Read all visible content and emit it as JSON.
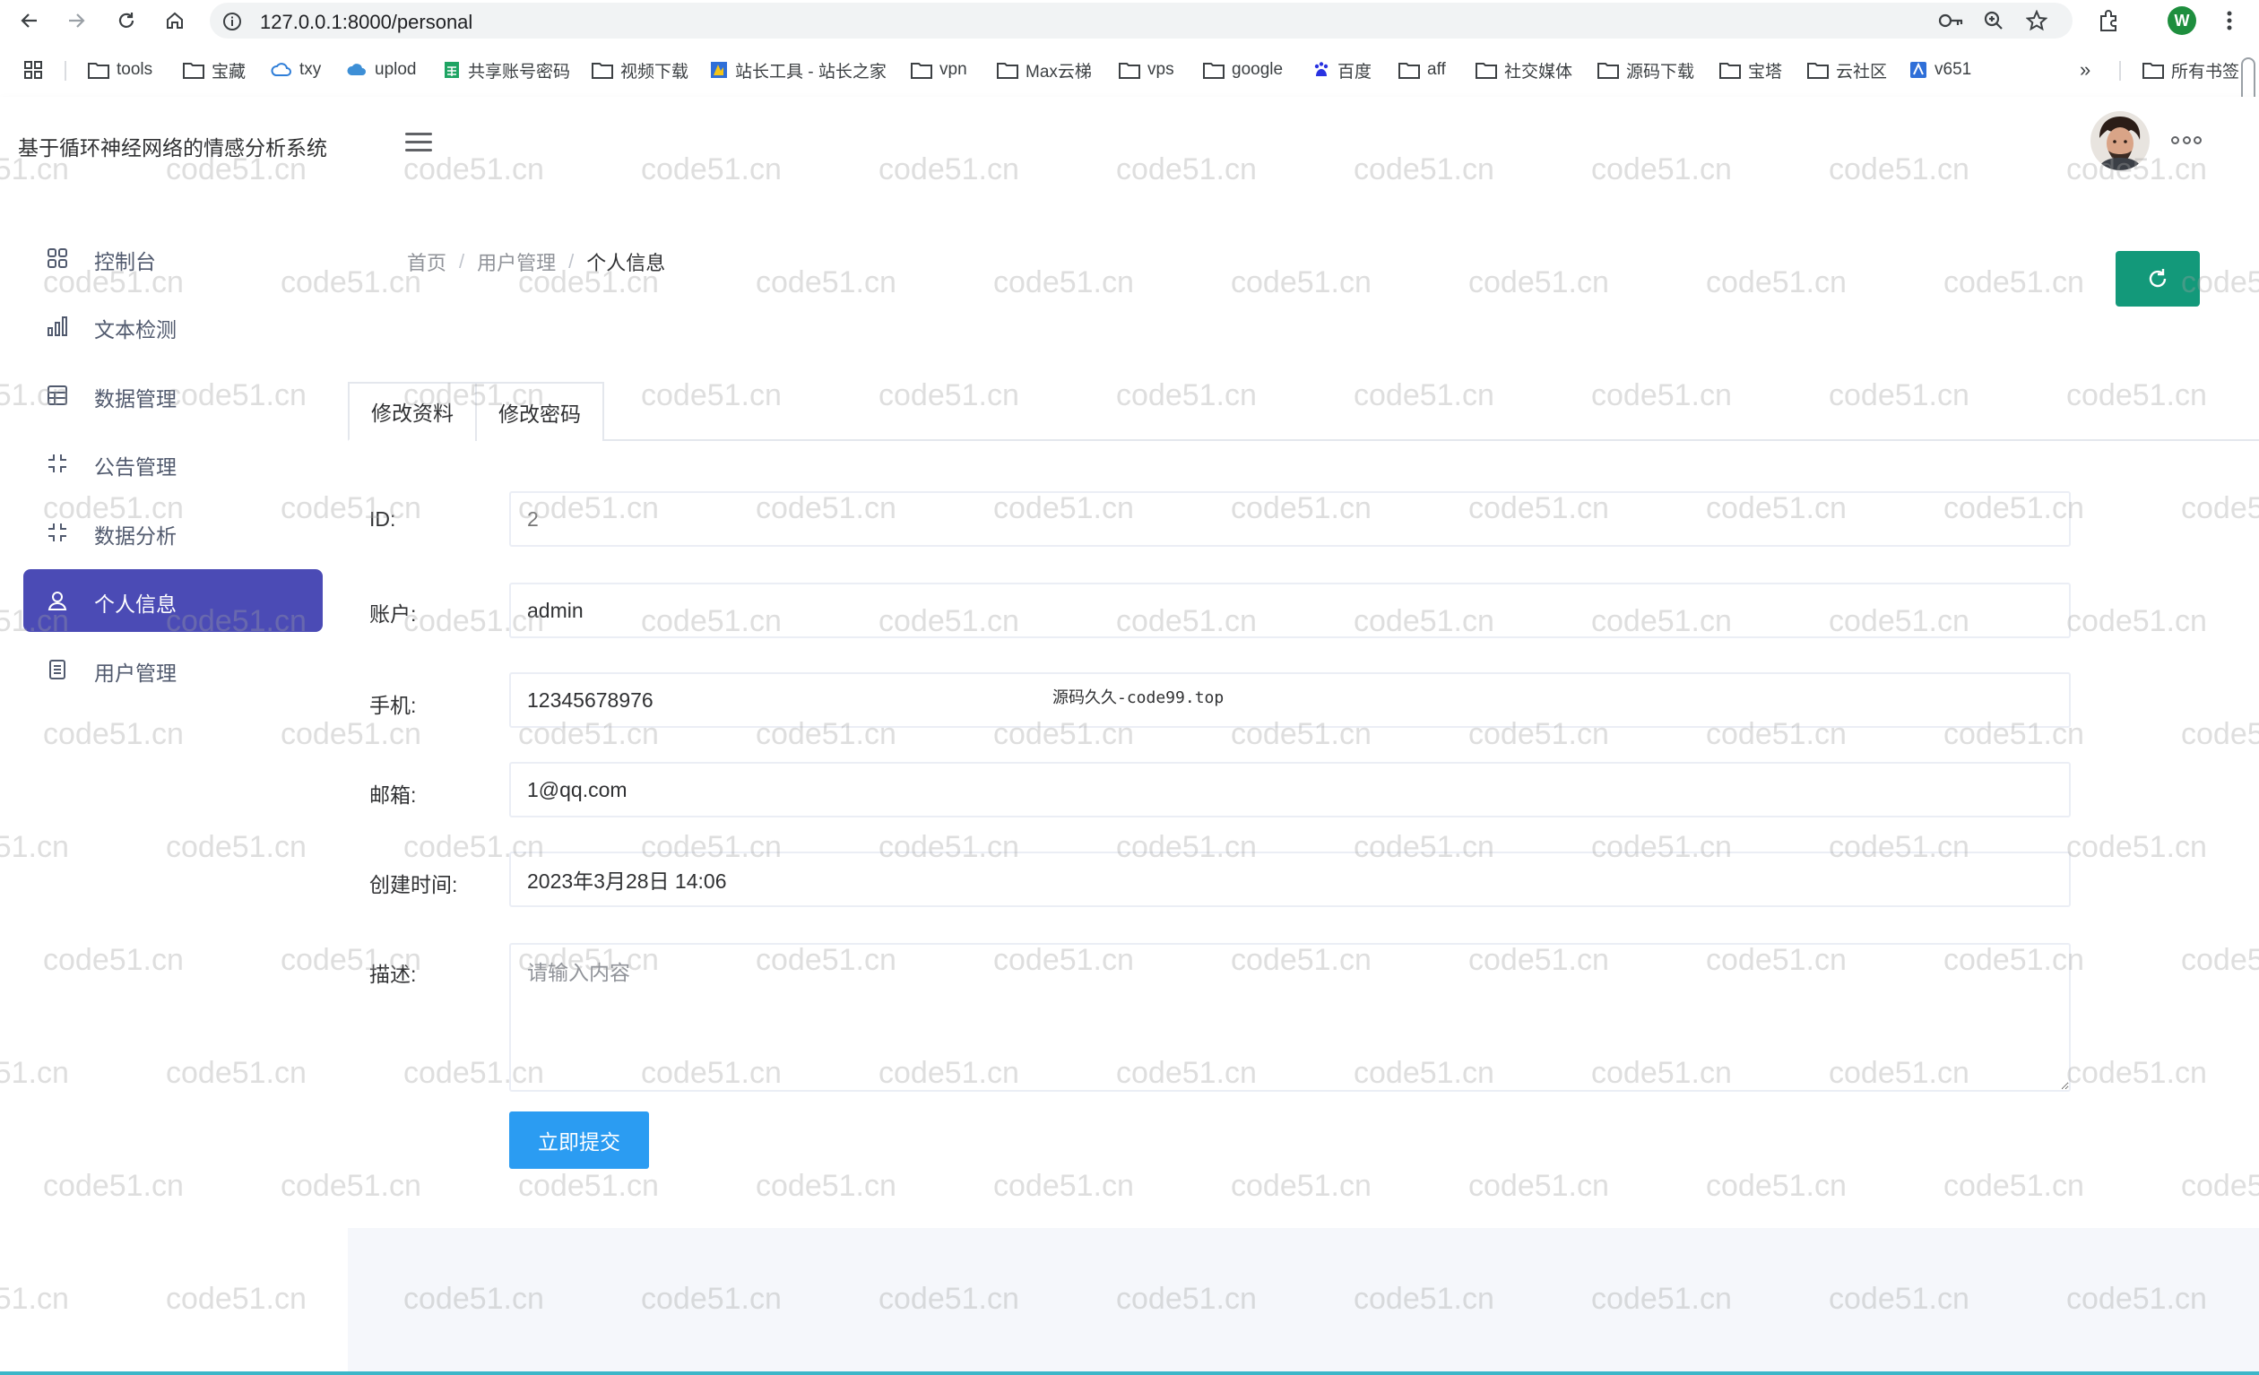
{
  "browser": {
    "url": "127.0.0.1:8000/personal",
    "profile_initial": "W",
    "bookmarks": [
      {
        "label": "tools",
        "icon": "folder-icon"
      },
      {
        "label": "宝藏",
        "icon": "folder-icon"
      },
      {
        "label": "txy",
        "icon": "cloud-icon"
      },
      {
        "label": "uplod",
        "icon": "cloud-icon"
      },
      {
        "label": "共享账号密码",
        "icon": "sheet-icon"
      },
      {
        "label": "视频下载",
        "icon": "folder-icon"
      },
      {
        "label": "站长工具 - 站长之家",
        "icon": "site-icon"
      },
      {
        "label": "vpn",
        "icon": "folder-icon"
      },
      {
        "label": "Max云梯",
        "icon": "folder-icon"
      },
      {
        "label": "vps",
        "icon": "folder-icon"
      },
      {
        "label": "google",
        "icon": "folder-icon"
      },
      {
        "label": "百度",
        "icon": "baidu-icon"
      },
      {
        "label": "aff",
        "icon": "folder-icon"
      },
      {
        "label": "社交媒体",
        "icon": "folder-icon"
      },
      {
        "label": "源码下载",
        "icon": "folder-icon"
      },
      {
        "label": "宝塔",
        "icon": "folder-icon"
      },
      {
        "label": "云社区",
        "icon": "folder-icon"
      },
      {
        "label": "v651",
        "icon": "v-icon"
      }
    ],
    "more_bookmarks": "»",
    "all_bookmarks": "所有书签"
  },
  "app": {
    "title": "基于循环神经网络的情感分析系统"
  },
  "sidebar": {
    "items": [
      {
        "label": "控制台",
        "icon": "dashboard-icon",
        "active": false
      },
      {
        "label": "文本检测",
        "icon": "bar-chart-icon",
        "active": false
      },
      {
        "label": "数据管理",
        "icon": "grid-icon",
        "active": false
      },
      {
        "label": "公告管理",
        "icon": "shrink-icon",
        "active": false
      },
      {
        "label": "数据分析",
        "icon": "shrink-icon",
        "active": false
      },
      {
        "label": "个人信息",
        "icon": "user-icon",
        "active": true
      },
      {
        "label": "用户管理",
        "icon": "document-icon",
        "active": false
      }
    ]
  },
  "breadcrumb": [
    "首页",
    "用户管理",
    "个人信息"
  ],
  "tabs": [
    "修改资料",
    "修改密码"
  ],
  "form": {
    "id_label": "ID:",
    "id_value": "2",
    "account_label": "账户:",
    "account_value": "admin",
    "phone_label": "手机:",
    "phone_value": "12345678976",
    "email_label": "邮箱:",
    "email_value": "1@qq.com",
    "created_label": "创建时间:",
    "created_value": "2023年3月28日 14:06",
    "desc_label": "描述:",
    "desc_placeholder": "请输入内容",
    "submit_label": "立即提交"
  },
  "note": "源码久久-code99.top",
  "watermark": "code51.cn",
  "colors": {
    "active_menu": "#4b4bb5",
    "refresh_button": "#13997a",
    "submit_button": "#2b9cf2"
  }
}
